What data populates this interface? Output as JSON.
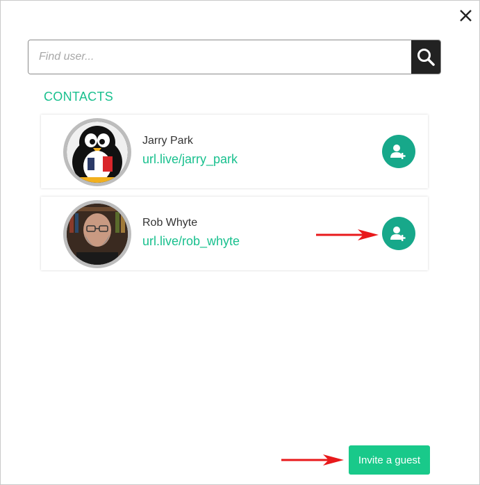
{
  "search": {
    "placeholder": "Find user..."
  },
  "contacts_section": {
    "title": "CONTACTS"
  },
  "contacts": [
    {
      "name": "Jarry Park",
      "url": "url.live/jarry_park",
      "avatar": "penguin-avatar"
    },
    {
      "name": "Rob Whyte",
      "url": "url.live/rob_whyte",
      "avatar": "person-photo-avatar"
    }
  ],
  "footer": {
    "invite_label": "Invite a guest"
  },
  "colors": {
    "accent": "#19c08e",
    "add_button": "#17a88a",
    "invite_button": "#19c98a",
    "arrow": "#e8191b"
  },
  "icons": {
    "close": "close-icon",
    "search": "search-icon",
    "add_user": "add-user-icon"
  }
}
